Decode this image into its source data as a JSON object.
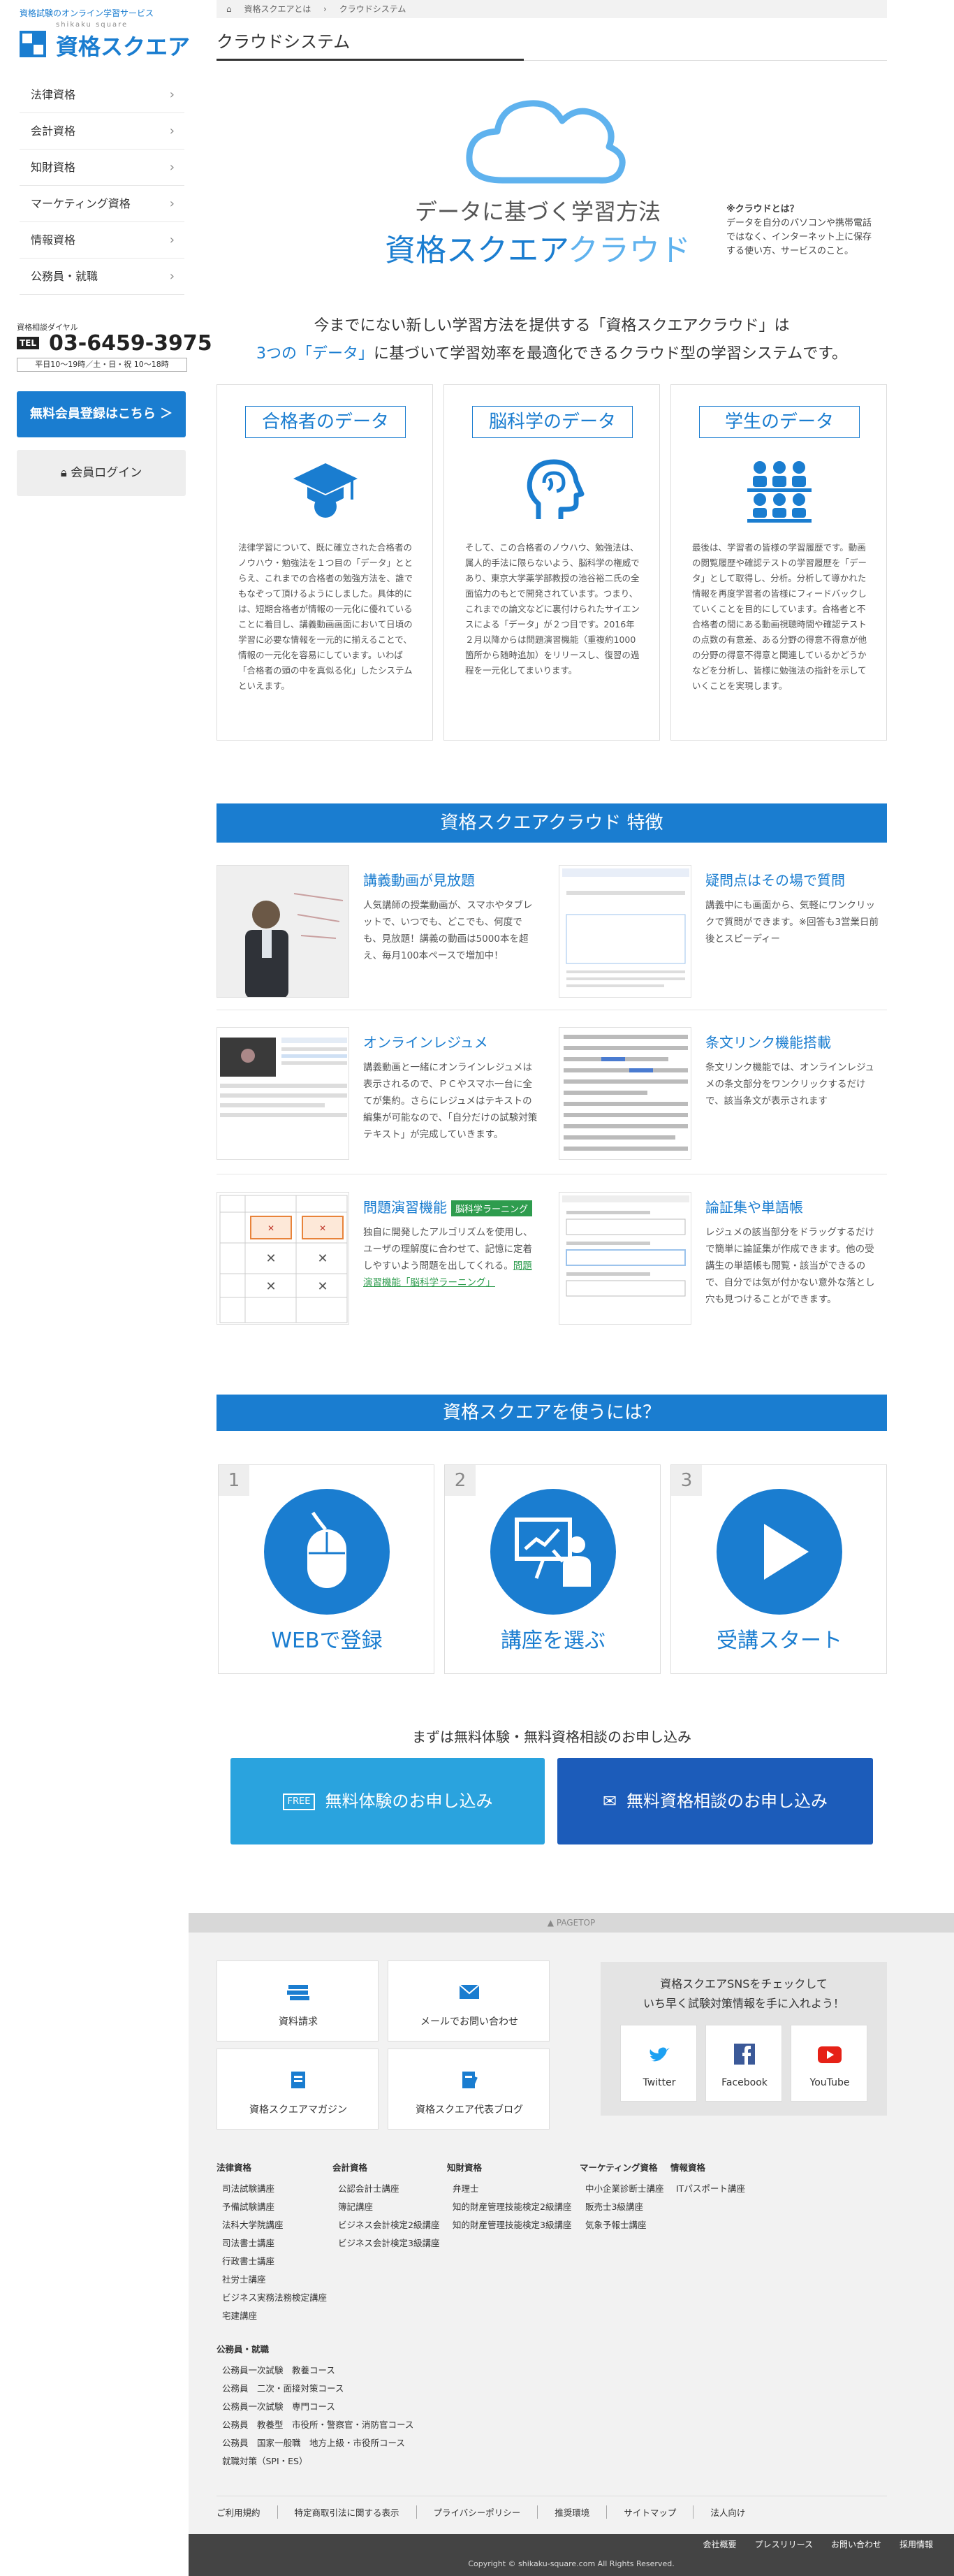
{
  "sidebar": {
    "tagline": "資格試験のオンライン学習サービス",
    "logo_sub": "shikaku square",
    "logo_main": "資格スクエア",
    "nav": [
      {
        "label": "法律資格"
      },
      {
        "label": "会計資格"
      },
      {
        "label": "知財資格"
      },
      {
        "label": "マーケティング資格"
      },
      {
        "label": "情報資格"
      },
      {
        "label": "公務員・就職"
      }
    ],
    "phone_label": "資格相談ダイヤル",
    "tel_badge": "TEL",
    "phone_number": "03-6459-3975",
    "phone_hours": "平日10～19時／土・日・祝 10～18時",
    "register_button": "無料会員登録はこちら ＞",
    "login_button": "会員ログイン"
  },
  "breadcrumb": {
    "items": [
      "資格スクエアとは",
      "クラウドシステム"
    ]
  },
  "page_title": "クラウドシステム",
  "hero": {
    "subtitle": "データに基づく学習方法",
    "title_main": "資格スクエア",
    "title_light": "クラウド",
    "note_title": "※クラウドとは？",
    "note_body": "データを自分のパソコンや携帯電話ではなく、インターネット上に保存する使い方、サービスのこと。"
  },
  "intro": {
    "line1": "今までにない新しい学習方法を提供する「資格スクエアクラウド」は",
    "line2_blue": "3つの「データ」",
    "line2_rest": "に基づいて学習効率を最適化できるクラウド型の学習システムです。"
  },
  "data_columns": [
    {
      "title": "合格者のデータ",
      "icon": "graduation-cap-icon",
      "text": "法律学習について、既に確立された合格者のノウハウ・勉強法を１つ目の「データ」ととらえ、これまでの合格者の勉強方法を、誰でもなぞって頂けるようにしました。具体的には、短期合格者が情報の一元化に優れていることに着目し、講義動画画面において日頃の学習に必要な情報を一元的に揃えることで、情報の一元化を容易にしています。いわば「合格者の頭の中を真似る化」したシステムといえます。"
    },
    {
      "title": "脳科学のデータ",
      "icon": "brain-head-icon",
      "text": "そして、この合格者のノウハウ、勉強法は、属人的手法に限らないよう、脳科学の権威であり、東京大学薬学部教授の池谷裕二氏の全面協力のもとで開発されています。つまり、これまでの論文などに裏付けられたサイエンスによる「データ」が２つ目です。2016年２月以降からは問題演習機能（重複約1000箇所から随時追加）をリリースし、復習の過程を一元化してまいります。"
    },
    {
      "title": "学生のデータ",
      "icon": "students-icon",
      "text": "最後は、学習者の皆様の学習履歴です。動画の閲覧履歴や確認テストの学習履歴を「データ」として取得し、分析。分析して導かれた情報を再度学習者の皆様にフィードバックしていくことを目的にしています。合格者と不合格者の間にある動画視聴時間や確認テストの点数の有意差、ある分野の得意不得意が他の分野の得意不得意と関連しているかどうかなどを分析し、皆様に勉強法の指針を示していくことを実現します。"
    }
  ],
  "features_band": "資格スクエアクラウド 特徴",
  "features": [
    {
      "title": "講義動画が見放題",
      "image": "lecture-video-thumbnail",
      "text": "人気講師の授業動画が、スマホやタブレットで、いつでも、どこでも、何度でも、見放題！講義の動画は5000本を超え、毎月100本ペースで増加中！"
    },
    {
      "title": "疑問点はその場で質問",
      "image": "question-form-thumbnail",
      "text": "講義中にも画面から、気軽にワンクリックで質問ができます。※回答も3営業日前後とスピーディー"
    },
    {
      "title": "オンラインレジュメ",
      "image": "online-resume-thumbnail",
      "text": "講義動画と一緒にオンラインレジュメは表示されるので、ＰＣやスマホ一台に全てが集約。さらにレジュメはテキストの編集が可能なので、「自分だけの試験対策テキスト」が完成していきます。"
    },
    {
      "title": "条文リンク機能搭載",
      "image": "article-link-thumbnail",
      "text": "条文リンク機能では、オンラインレジュメの条文部分をワンクリックするだけで、該当条文が表示されます"
    },
    {
      "title": "問題演習機能",
      "tag": "脳科学ラーニング",
      "image": "quiz-thumbnail",
      "text": "独自に開発したアルゴリズムを使用し、ユーザの理解度に合わせて、記憶に定着しやすいよう問題を出してくれる。",
      "link": "問題演習機能「脳科学ラーニング」"
    },
    {
      "title": "論証集や単語帳",
      "image": "wordbook-thumbnail",
      "text": "レジュメの該当部分をドラッグするだけで簡単に論証集が作成できます。他の受講生の単語帳も閲覧・該当ができるので、自分では気が付かない意外な落とし穴も見つけることができます。"
    }
  ],
  "how_band": "資格スクエアを使うには？",
  "steps": [
    {
      "num": "1",
      "label": "WEBで登録",
      "icon": "mouse-icon"
    },
    {
      "num": "2",
      "label": "講座を選ぶ",
      "icon": "presentation-icon"
    },
    {
      "num": "3",
      "label": "受講スタート",
      "icon": "play-icon"
    }
  ],
  "trial": {
    "heading": "まずは無料体験・無料資格相談のお申し込み",
    "trial_badge": "FREE",
    "trial_button": "無料体験のお申し込み",
    "consult_button": "無料資格相談のお申し込み"
  },
  "footer": {
    "pagetop": "PAGETOP",
    "boxes": [
      {
        "label": "資料請求",
        "icon": "books-icon"
      },
      {
        "label": "メールでお問い合わせ",
        "icon": "mail-icon"
      },
      {
        "label": "資格スクエアマガジン",
        "icon": "magazine-icon"
      },
      {
        "label": "資格スクエア代表ブログ",
        "icon": "blog-icon"
      }
    ],
    "sns_title": "資格スクエアSNSをチェックして\nいち早く試験対策情報を手に入れよう！",
    "sns": [
      {
        "label": "Twitter",
        "icon": "twitter-icon",
        "color": "#1da1f2"
      },
      {
        "label": "Facebook",
        "icon": "facebook-icon",
        "color": "#3b5998"
      },
      {
        "label": "YouTube",
        "icon": "youtube-icon",
        "color": "#e62117"
      }
    ],
    "columns": [
      {
        "heading": "法律資格",
        "items": [
          "司法試験講座",
          "予備試験講座",
          "法科大学院講座",
          "司法書士講座",
          "行政書士講座",
          "社労士講座",
          "ビジネス実務法務検定講座",
          "宅建講座"
        ]
      },
      {
        "heading": "会計資格",
        "items": [
          "公認会計士講座",
          "簿記講座",
          "ビジネス会計検定2級講座",
          "ビジネス会計検定3級講座"
        ]
      },
      {
        "heading": "知財資格",
        "items": [
          "弁理士",
          "知的財産管理技能検定2級講座",
          "知的財産管理技能検定3級講座"
        ]
      },
      {
        "heading": "マーケティング資格",
        "items": [
          "中小企業診断士講座",
          "販売士3級講座",
          "気象予報士講座"
        ]
      },
      {
        "heading": "情報資格",
        "items": [
          "ITパスポート講座"
        ]
      }
    ],
    "koumuin": {
      "heading": "公務員・就職",
      "items": [
        "公務員一次試験　教養コース",
        "公務員　二次・面接対策コース",
        "公務員一次試験　専門コース",
        "公務員　教養型　市役所・警察官・消防官コース",
        "公務員　国家一般職　地方上級・市役所コース",
        "就職対策（SPI・ES）"
      ]
    },
    "legal": [
      "ご利用規約",
      "特定商取引法に関する表示",
      "プライバシーポリシー",
      "推奨環境",
      "サイトマップ",
      "法人向け"
    ],
    "bottom_links": [
      "会社概要",
      "プレスリリース",
      "お問い合わせ",
      "採用情報"
    ],
    "copyright": "Copyright © shikaku-square.com All Rights Reserved."
  },
  "colors": {
    "accent": "#1a7dd0",
    "accent_light": "#5fb2ee",
    "green": "#2e9c4e",
    "trial": "#2aa3de",
    "consult": "#1c5cba"
  }
}
